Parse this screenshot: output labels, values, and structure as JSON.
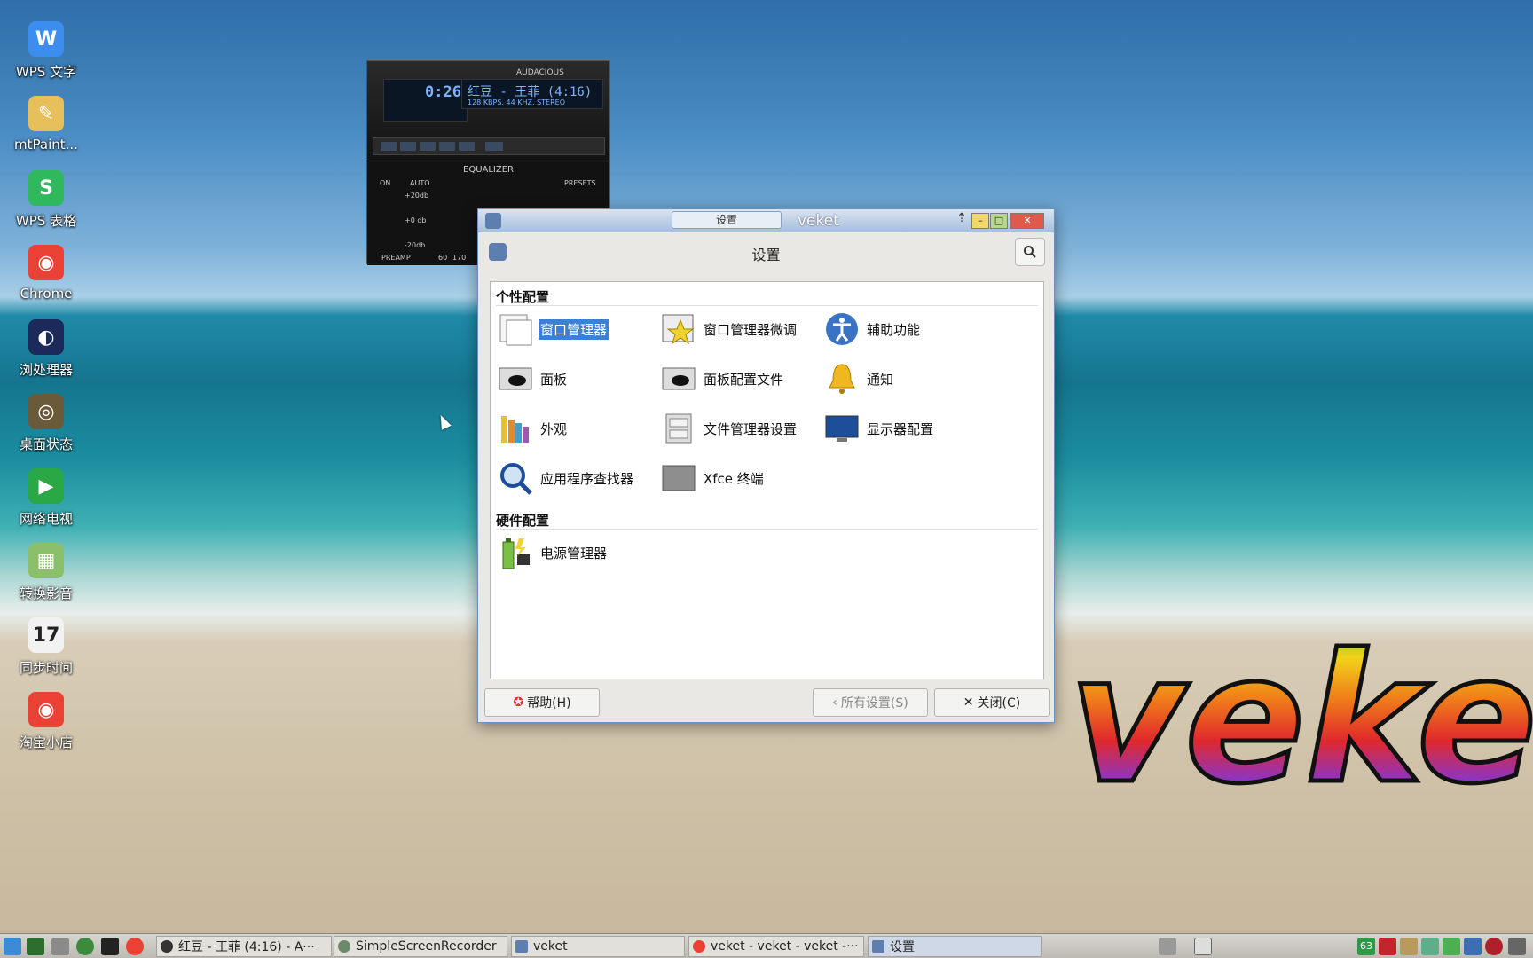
{
  "desktop": {
    "icons": [
      {
        "label": "WPS 文字",
        "icon": "wps-writer-icon",
        "color": "#3c8df0",
        "glyph": "W"
      },
      {
        "label": "mtPaint...",
        "icon": "mtpaint-icon",
        "color": "#e7c05b",
        "glyph": "✎"
      },
      {
        "label": "WPS 表格",
        "icon": "wps-spreadsheet-icon",
        "color": "#2fb85c",
        "glyph": "S"
      },
      {
        "label": "Chrome",
        "icon": "chrome-icon",
        "color": "#e94235",
        "glyph": "◉"
      },
      {
        "label": "浏处理器",
        "icon": "browser-processor-icon",
        "color": "#1b2a5a",
        "glyph": "◐"
      },
      {
        "label": "桌面状态",
        "icon": "desktop-status-icon",
        "color": "#6b5a3a",
        "glyph": "◎"
      },
      {
        "label": "网络电视",
        "icon": "network-tv-icon",
        "color": "#2aa845",
        "glyph": "▶"
      },
      {
        "label": "转换影音",
        "icon": "media-convert-icon",
        "color": "#8cbf6a",
        "glyph": "▦"
      },
      {
        "label": "同步时间",
        "icon": "calendar-icon",
        "color": "#f2f2f2",
        "glyph": "17"
      },
      {
        "label": "淘宝小店",
        "icon": "chrome-icon",
        "color": "#e94235",
        "glyph": "◉"
      }
    ]
  },
  "audacious": {
    "title": "AUDACIOUS",
    "time": "0:26",
    "song": "红豆 - 王菲 (4:16)",
    "meta": "128 KBPS. 44 KHZ. STEREO",
    "equalizer_title": "EQUALIZER",
    "eq_on": "ON",
    "eq_auto": "AUTO",
    "eq_presets": "PRESETS",
    "eq_plus": "+20db",
    "eq_zero": "+0 db",
    "eq_minus": "-20db",
    "eq_preamp": "PREAMP",
    "eq_60": "60",
    "eq_170": "170"
  },
  "window": {
    "title": "veket",
    "tab_label": "设置",
    "header_title": "设置"
  },
  "sections": [
    {
      "title": "个性配置",
      "items": [
        {
          "label": "窗口管理器",
          "icon": "window-manager-icon",
          "selected": true
        },
        {
          "label": "窗口管理器微调",
          "icon": "window-manager-tweaks-icon"
        },
        {
          "label": "辅助功能",
          "icon": "accessibility-icon"
        },
        {
          "label": "面板",
          "icon": "panel-icon"
        },
        {
          "label": "面板配置文件",
          "icon": "panel-profiles-icon"
        },
        {
          "label": "通知",
          "icon": "notification-bell-icon"
        },
        {
          "label": "外观",
          "icon": "appearance-icon"
        },
        {
          "label": "文件管理器设置",
          "icon": "file-manager-settings-icon"
        },
        {
          "label": "显示器配置",
          "icon": "display-icon"
        },
        {
          "label": "应用程序查找器",
          "icon": "app-finder-icon"
        },
        {
          "label": "Xfce 终端",
          "icon": "terminal-icon"
        }
      ]
    },
    {
      "title": "硬件配置",
      "items": [
        {
          "label": "电源管理器",
          "icon": "power-manager-icon"
        }
      ]
    }
  ],
  "footer": {
    "help": "帮助(H)",
    "all_settings": "所有设置(S)",
    "close": "关闭(C)"
  },
  "taskbar": {
    "tasks": [
      {
        "label": "红豆 - 王菲 (4:16) - A···",
        "icon": "audacious-icon"
      },
      {
        "label": "SimpleScreenRecorder",
        "icon": "recorder-icon"
      },
      {
        "label": "veket",
        "icon": "folder-icon"
      },
      {
        "label": "veket - veket - veket -···",
        "icon": "chrome-icon"
      },
      {
        "label": "设置",
        "icon": "settings-icon"
      }
    ],
    "tray_badge": "63"
  },
  "logo_text": "veket",
  "colors": {
    "accent": "#3d7fd6",
    "titlebar": "#a8bfdc",
    "close_button": "#e05a4b"
  }
}
